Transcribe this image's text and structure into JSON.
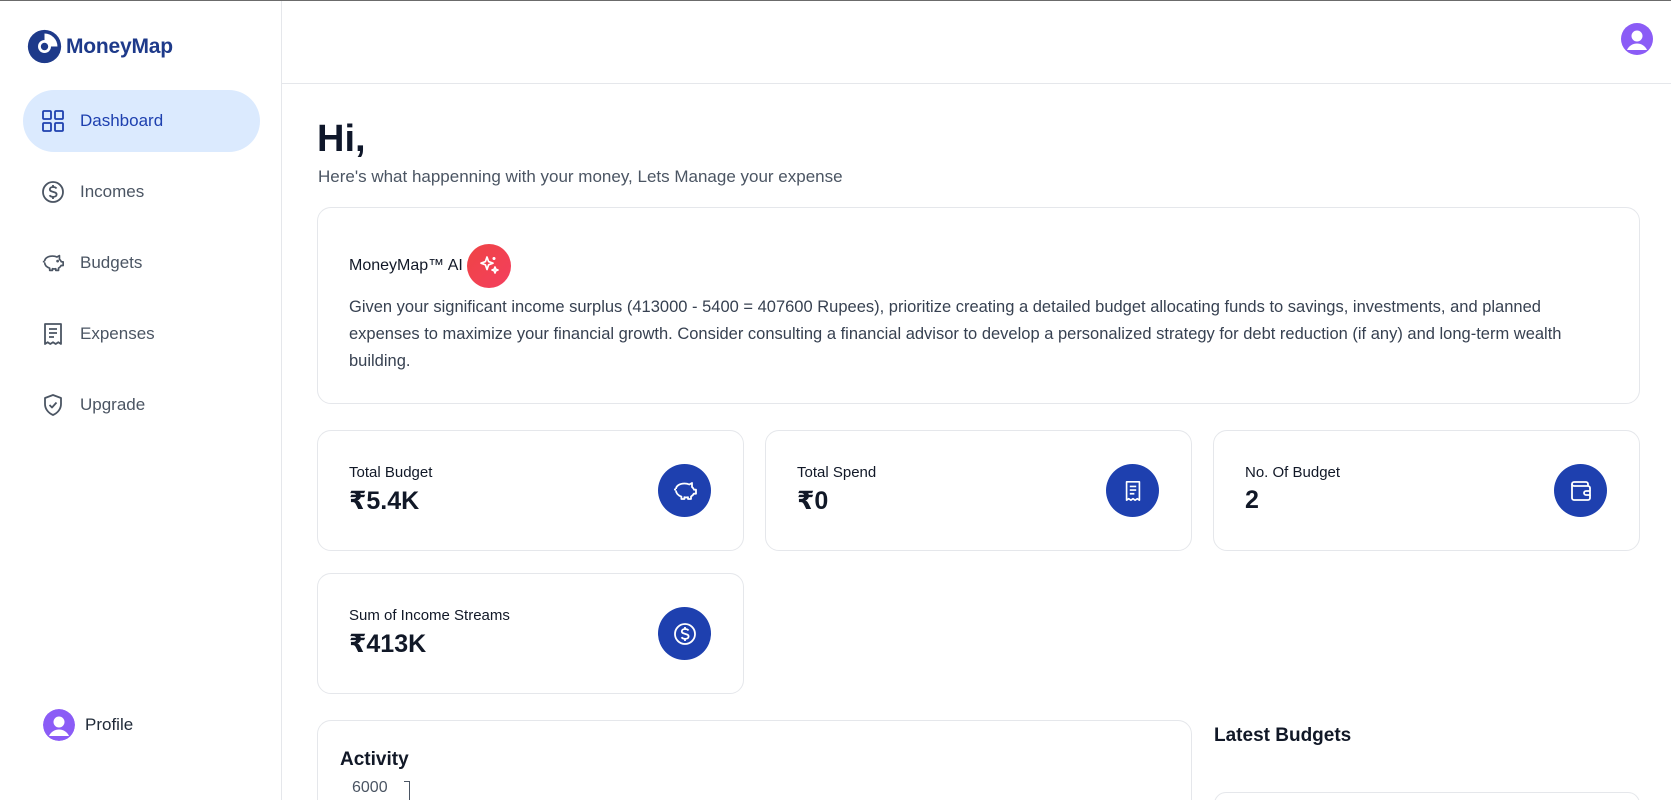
{
  "app": {
    "name": "MoneyMap"
  },
  "sidebar": {
    "items": [
      {
        "label": "Dashboard",
        "icon": "dashboard-grid-icon",
        "active": true
      },
      {
        "label": "Incomes",
        "icon": "dollar-circle-icon",
        "active": false
      },
      {
        "label": "Budgets",
        "icon": "piggy-bank-icon",
        "active": false
      },
      {
        "label": "Expenses",
        "icon": "receipt-icon",
        "active": false
      },
      {
        "label": "Upgrade",
        "icon": "shield-check-icon",
        "active": false
      }
    ],
    "profile_label": "Profile"
  },
  "main": {
    "greeting": "Hi,",
    "subtitle": "Here's what happenning with your money, Lets Manage your expense",
    "ai": {
      "title": "MoneyMap™ AI",
      "text": "Given your significant income surplus (413000 - 5400 = 407600 Rupees), prioritize creating a detailed budget allocating funds to savings, investments, and planned expenses to maximize your financial growth. Consider consulting a financial advisor to develop a personalized strategy for debt reduction (if any) and long-term wealth building."
    },
    "stats": [
      {
        "label": "Total Budget",
        "value": "₹5.4K",
        "icon": "piggy-bank-icon"
      },
      {
        "label": "Total Spend",
        "value": "₹0",
        "icon": "receipt-icon"
      },
      {
        "label": "No. Of Budget",
        "value": "2",
        "icon": "wallet-icon"
      },
      {
        "label": "Sum of Income Streams",
        "value": "₹413K",
        "icon": "dollar-circle-icon"
      }
    ],
    "activity": {
      "title": "Activity",
      "y_tick": "6000"
    },
    "latest_budgets_title": "Latest Budgets"
  },
  "colors": {
    "primary": "#1e40af",
    "active_bg": "#dbeafe",
    "ai_badge": "#ef4444",
    "avatar": "#8b5cf6"
  }
}
